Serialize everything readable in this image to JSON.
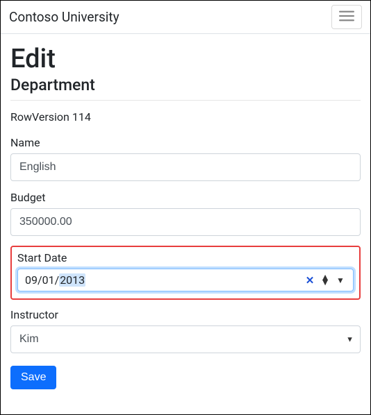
{
  "navbar": {
    "brand": "Contoso University"
  },
  "page": {
    "heading": "Edit",
    "subheading": "Department"
  },
  "rowversion": {
    "label": "RowVersion",
    "value": "114"
  },
  "form": {
    "name": {
      "label": "Name",
      "value": "English"
    },
    "budget": {
      "label": "Budget",
      "value": "350000.00"
    },
    "start_date": {
      "label": "Start Date",
      "month": "09",
      "day": "01",
      "year": "2013",
      "sep": "/"
    },
    "instructor": {
      "label": "Instructor",
      "value": "Kim"
    },
    "save_label": "Save"
  }
}
